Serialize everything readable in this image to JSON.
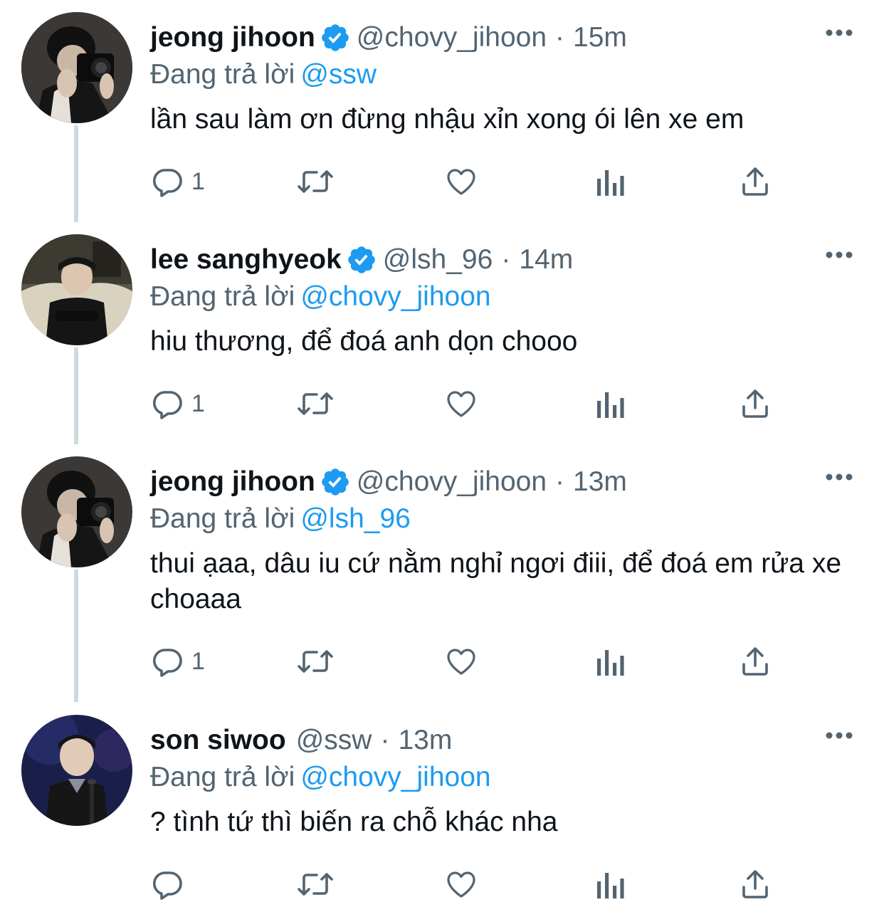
{
  "tweets": [
    {
      "display_name": "jeong jihoon",
      "verified": true,
      "handle": "@chovy_jihoon",
      "separator": "·",
      "time": "15m",
      "reply_prefix": "Đang trả lời",
      "reply_to": "@ssw",
      "text": "lần sau làm ơn đừng nhậu xỉn xong ói lên xe em",
      "reply_count": "1"
    },
    {
      "display_name": "lee sanghyeok",
      "verified": true,
      "handle": "@lsh_96",
      "separator": "·",
      "time": "14m",
      "reply_prefix": "Đang trả lời",
      "reply_to": "@chovy_jihoon",
      "text": "hiu thương, để đoá anh dọn chooo",
      "reply_count": "1"
    },
    {
      "display_name": "jeong jihoon",
      "verified": true,
      "handle": "@chovy_jihoon",
      "separator": "·",
      "time": "13m",
      "reply_prefix": "Đang trả lời",
      "reply_to": "@lsh_96",
      "text": "thui ạaa, dâu iu cứ nằm nghỉ ngơi điii, để đoá em rửa xe choaaa",
      "reply_count": "1"
    },
    {
      "display_name": "son siwoo",
      "verified": false,
      "handle": "@ssw",
      "separator": "·",
      "time": "13m",
      "reply_prefix": "Đang trả lời",
      "reply_to": "@chovy_jihoon",
      "text": "? tình tứ thì biến ra chỗ khác nha",
      "reply_count": ""
    }
  ],
  "icons": {
    "reply": "speech-bubble-icon",
    "retweet": "retweet-icon",
    "like": "heart-icon",
    "analytics": "bar-chart-icon",
    "share": "share-upload-icon",
    "more": "more-dots-icon",
    "verified": "verified-badge-icon"
  },
  "colors": {
    "text": "#0f1419",
    "secondary": "#536471",
    "link": "#1d9bf0",
    "verified": "#1d9bf0",
    "thread_line": "#cfd9de"
  }
}
